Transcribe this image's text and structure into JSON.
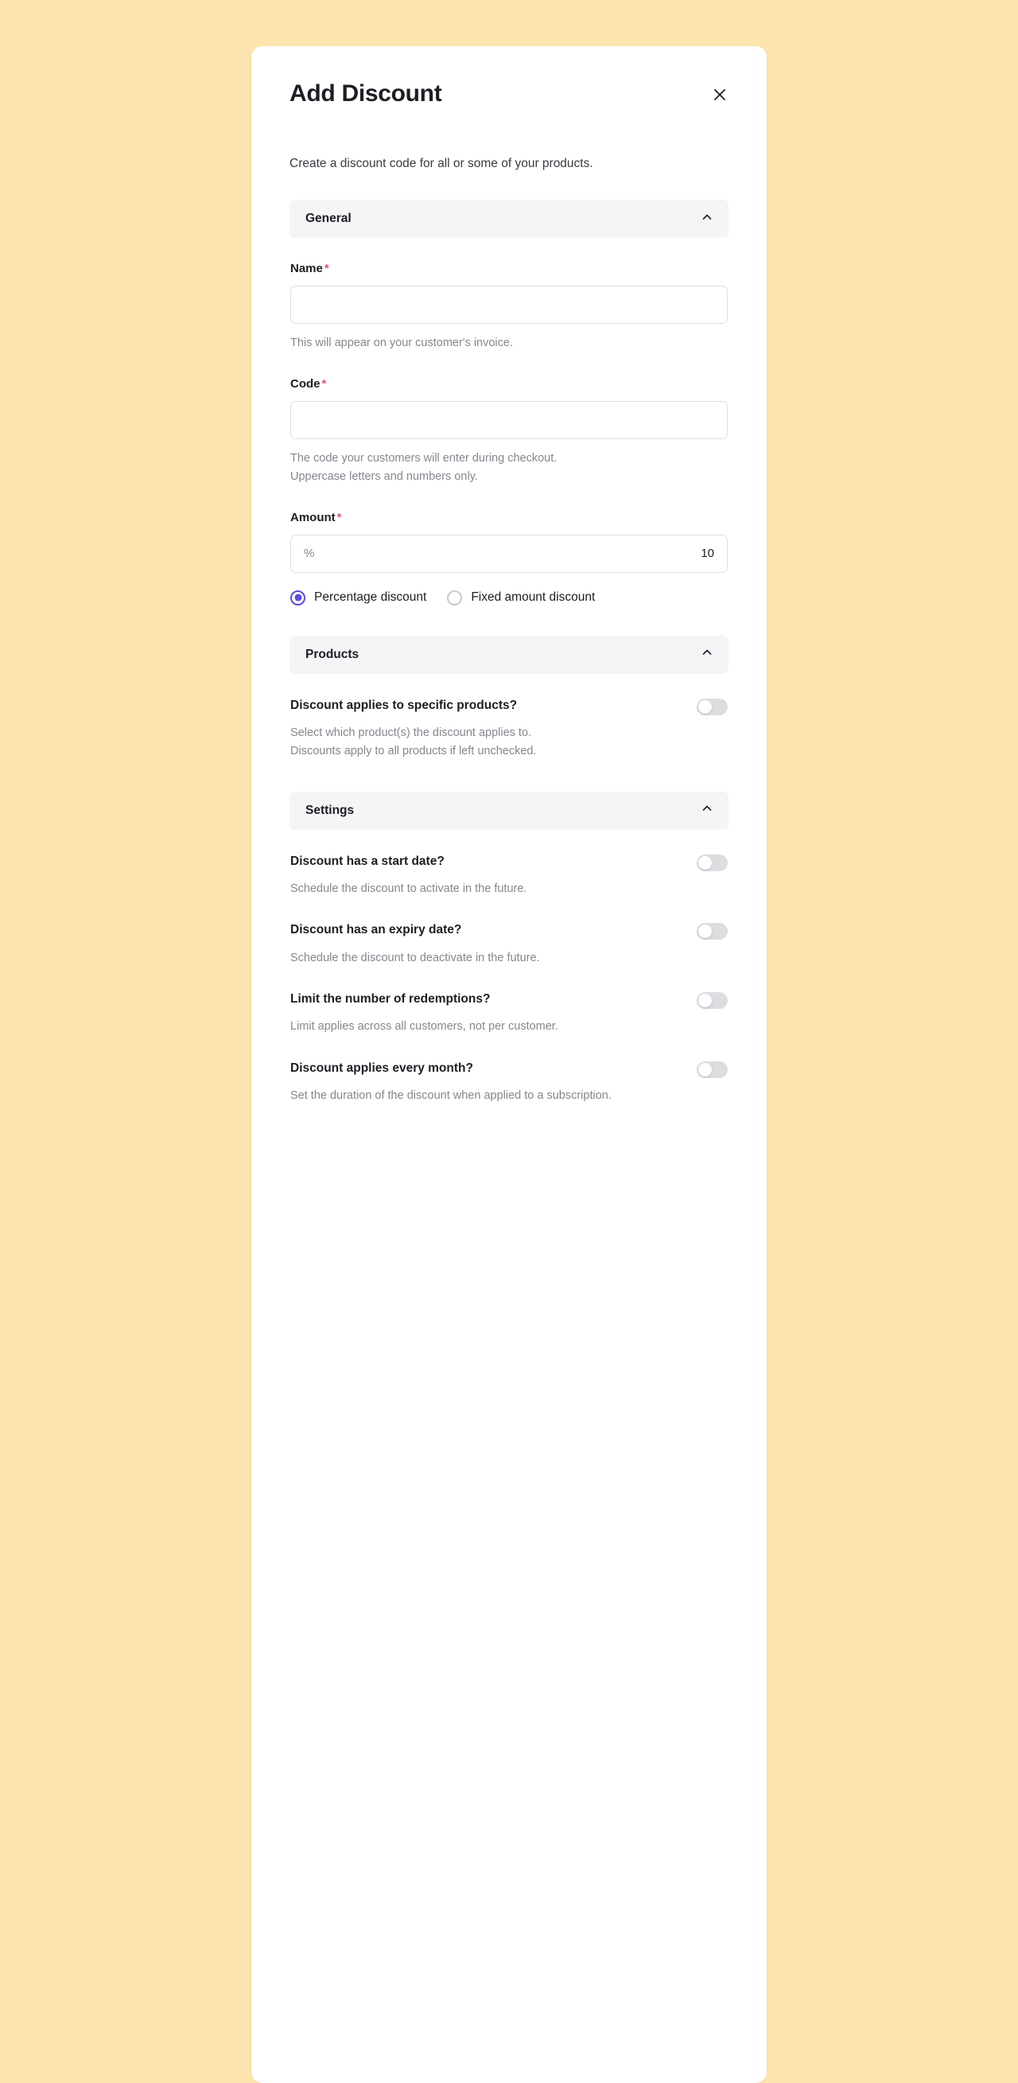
{
  "theme": {
    "page_background": "#FCE5AE",
    "modal_background": "#FFFFFF",
    "accent": "#5B4BE3",
    "required_marker": "#E8527E",
    "section_header_background": "#F5F5F7"
  },
  "modal": {
    "title": "Add Discount",
    "close_icon": "close-icon",
    "subtitle": "Create a discount code for all or some of your products."
  },
  "sections": {
    "general": {
      "title": "General",
      "chevron": "chevron-up-icon",
      "expanded": true,
      "fields": {
        "name": {
          "label": "Name",
          "required_marker": "*",
          "value": "",
          "placeholder": "",
          "helper": "This will appear on your customer's invoice."
        },
        "code": {
          "label": "Code",
          "required_marker": "*",
          "value": "",
          "placeholder": "",
          "helper_line1": "The code your customers will enter during checkout.",
          "helper_line2": "Uppercase letters and numbers only."
        },
        "amount": {
          "label": "Amount",
          "required_marker": "*",
          "prefix": "%",
          "value": "10"
        }
      },
      "discount_type": {
        "options": [
          {
            "label": "Percentage discount",
            "selected": true
          },
          {
            "label": "Fixed amount discount",
            "selected": false
          }
        ]
      }
    },
    "products": {
      "title": "Products",
      "chevron": "chevron-up-icon",
      "expanded": true,
      "rows": [
        {
          "question": "Discount applies to specific products?",
          "helper_line1": "Select which product(s) the discount applies to.",
          "helper_line2": "Discounts apply to all products if left unchecked.",
          "toggle_on": false
        }
      ]
    },
    "settings": {
      "title": "Settings",
      "chevron": "chevron-up-icon",
      "expanded": true,
      "rows": [
        {
          "question": "Discount has a start date?",
          "helper_line1": "Schedule the discount to activate in the future.",
          "toggle_on": false
        },
        {
          "question": "Discount has an expiry date?",
          "helper_line1": "Schedule the discount to deactivate in the future.",
          "toggle_on": false
        },
        {
          "question": "Limit the number of redemptions?",
          "helper_line1": "Limit applies across all customers, not per customer.",
          "toggle_on": false
        },
        {
          "question": "Discount applies every month?",
          "helper_line1": "Set the duration of the discount when applied to a subscription.",
          "toggle_on": false
        }
      ]
    }
  }
}
